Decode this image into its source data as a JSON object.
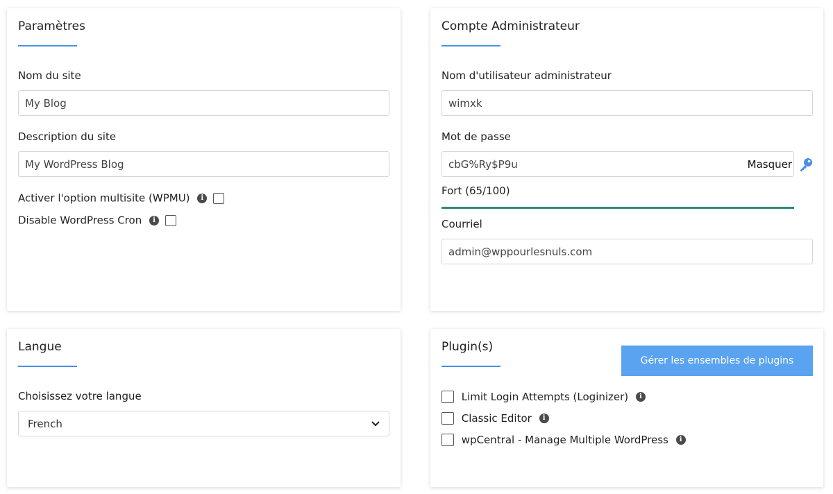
{
  "settings": {
    "title": "Paramètres",
    "site_name_label": "Nom du site",
    "site_name_value": "My Blog",
    "site_desc_label": "Description du site",
    "site_desc_value": "My WordPress Blog",
    "multisite_label": "Activer l'option multisite (WPMU)",
    "multisite_checked": false,
    "cron_label": "Disable WordPress Cron",
    "cron_checked": false
  },
  "admin": {
    "title": "Compte Administrateur",
    "username_label": "Nom d'utilisateur administrateur",
    "username_value": "wimxk",
    "password_label": "Mot de passe",
    "password_value": "cbG%Ry$P9u",
    "toggle_label": "Masquer",
    "strength_text": "Fort (65/100)",
    "strength_value": 65,
    "strength_color": "#2e8b75",
    "email_label": "Courriel",
    "email_value": "admin@wppourlesnuls.com"
  },
  "language": {
    "title": "Langue",
    "select_label": "Choisissez votre langue",
    "selected": "French"
  },
  "plugins": {
    "title": "Plugin(s)",
    "manage_button": "Gérer les ensembles de plugins",
    "items": [
      {
        "label": "Limit Login Attempts (Loginizer)",
        "checked": false
      },
      {
        "label": "Classic Editor",
        "checked": false
      },
      {
        "label": "wpCentral - Manage Multiple WordPress",
        "checked": false
      }
    ]
  },
  "colors": {
    "accent": "#4a90e2",
    "button": "#5aa3f0"
  }
}
